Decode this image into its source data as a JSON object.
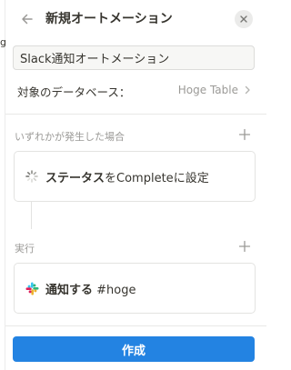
{
  "backdrop": {
    "fragment": "g"
  },
  "header": {
    "title": "新規オートメーション"
  },
  "name_field": {
    "value": "Slack通知オートメーション"
  },
  "database": {
    "label": "対象のデータベース：",
    "value": "Hoge Table"
  },
  "trigger_section": {
    "label": "いずれかが発生した場合",
    "card": {
      "part1": "ステータス",
      "part2": "を",
      "part3": "Complete",
      "part4": "に設定"
    }
  },
  "action_section": {
    "label": "実行",
    "card": {
      "part1": "通知する",
      "part2": " #hoge"
    }
  },
  "footer": {
    "create_label": "作成"
  },
  "colors": {
    "primary": "#2383e2",
    "text": "#37352f",
    "muted": "#9b9a97"
  },
  "icons": {
    "back": "arrow-left-icon",
    "close": "close-icon",
    "chevron": "chevron-right-icon",
    "add": "plus-icon",
    "trigger": "loading-spinner-icon",
    "action": "slack-icon"
  }
}
